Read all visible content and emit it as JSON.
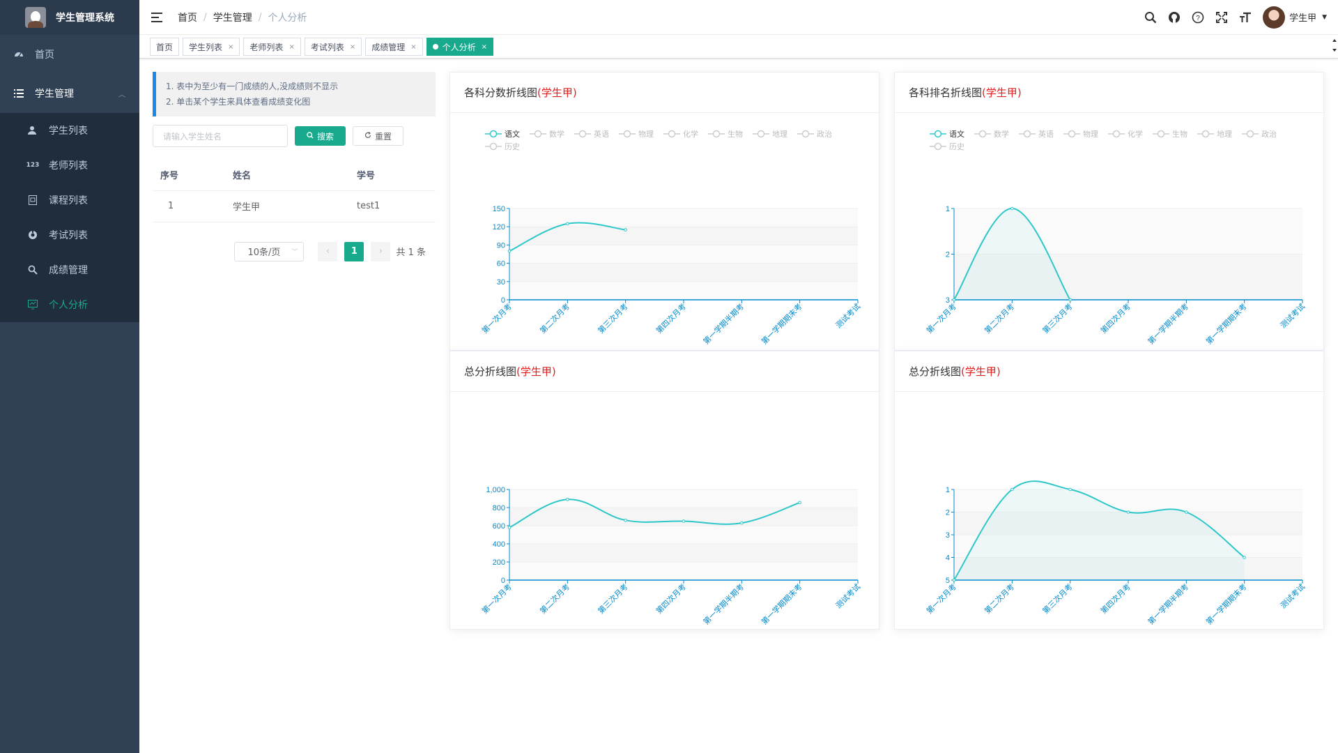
{
  "app": {
    "title": "学生管理系统"
  },
  "sidebar": {
    "home": "首页",
    "group": "学生管理",
    "items": [
      {
        "label": "学生列表",
        "icon": "user-icon"
      },
      {
        "label": "老师列表",
        "icon": "number-icon"
      },
      {
        "label": "课程列表",
        "icon": "course-icon"
      },
      {
        "label": "考试列表",
        "icon": "exam-icon"
      },
      {
        "label": "成绩管理",
        "icon": "search-icon"
      },
      {
        "label": "个人分析",
        "icon": "analysis-icon"
      }
    ]
  },
  "breadcrumb": {
    "home": "首页",
    "section": "学生管理",
    "current": "个人分析"
  },
  "user": {
    "name": "学生甲"
  },
  "tags": [
    {
      "label": "首页",
      "closable": false,
      "active": false
    },
    {
      "label": "学生列表",
      "closable": true,
      "active": false
    },
    {
      "label": "老师列表",
      "closable": true,
      "active": false
    },
    {
      "label": "考试列表",
      "closable": true,
      "active": false
    },
    {
      "label": "成绩管理",
      "closable": true,
      "active": false
    },
    {
      "label": "个人分析",
      "closable": true,
      "active": true
    }
  ],
  "tips": {
    "line1": "1. 表中为至少有一门成绩的人,没成绩则不显示",
    "line2": "2. 单击某个学生来具体查看成绩变化图"
  },
  "search": {
    "placeholder": "请输入学生姓名",
    "search_label": "搜索",
    "reset_label": "重置"
  },
  "table": {
    "headers": [
      "序号",
      "姓名",
      "学号"
    ],
    "rows": [
      [
        "1",
        "学生甲",
        "test1"
      ]
    ]
  },
  "pagination": {
    "page_size": "10条/页",
    "current_page": "1",
    "total": "共 1 条"
  },
  "colors": {
    "accent": "#19aa8d",
    "sidebar": "#304156",
    "line": "#2ec7c9",
    "axis": "#008acd",
    "highlight": "#e02020"
  },
  "cards": [
    {
      "title": "各科分数折线图",
      "who": "(学生甲)"
    },
    {
      "title": "各科排名折线图",
      "who": "(学生甲)"
    },
    {
      "title": "总分折线图",
      "who": "(学生甲)"
    },
    {
      "title": "总分折线图",
      "who": "(学生甲)"
    }
  ],
  "chart_data": [
    {
      "type": "line",
      "title": "各科分数折线图(学生甲)",
      "legend": [
        "语文",
        "数学",
        "英语",
        "物理",
        "化学",
        "生物",
        "地理",
        "政治",
        "历史"
      ],
      "legend_active": "语文",
      "categories": [
        "第一次月考",
        "第二次月考",
        "第三次月考",
        "第四次月考",
        "第一学期半期考",
        "第一学期期末考",
        "测试考试"
      ],
      "series": [
        {
          "name": "语文",
          "values": [
            80,
            125,
            115,
            null,
            null,
            null,
            null
          ]
        }
      ],
      "yticks": [
        0,
        30,
        60,
        90,
        120,
        150
      ],
      "ylim": [
        0,
        150
      ],
      "inverse": false
    },
    {
      "type": "line",
      "title": "各科排名折线图(学生甲)",
      "legend": [
        "语文",
        "数学",
        "英语",
        "物理",
        "化学",
        "生物",
        "地理",
        "政治",
        "历史"
      ],
      "legend_active": "语文",
      "categories": [
        "第一次月考",
        "第二次月考",
        "第三次月考",
        "第四次月考",
        "第一学期半期考",
        "第一学期期末考",
        "测试考试"
      ],
      "series": [
        {
          "name": "语文",
          "values": [
            3,
            1,
            3,
            null,
            null,
            null,
            null
          ]
        }
      ],
      "yticks": [
        1,
        2,
        3
      ],
      "ylim": [
        1,
        3
      ],
      "inverse": true,
      "area": true
    },
    {
      "type": "line",
      "title": "总分折线图(学生甲)",
      "legend": [],
      "categories": [
        "第一次月考",
        "第二次月考",
        "第三次月考",
        "第四次月考",
        "第一学期半期考",
        "第一学期期末考",
        "测试考试"
      ],
      "series": [
        {
          "name": "",
          "values": [
            580,
            890,
            660,
            650,
            630,
            855,
            null
          ]
        }
      ],
      "yticks": [
        0,
        200,
        400,
        600,
        800,
        1000
      ],
      "ytick_labels": [
        "0",
        "200",
        "400",
        "600",
        "800",
        "1,000"
      ],
      "ylim": [
        0,
        1000
      ],
      "inverse": false
    },
    {
      "type": "line",
      "title": "总分折线图(学生甲)",
      "legend": [],
      "categories": [
        "第一次月考",
        "第二次月考",
        "第三次月考",
        "第四次月考",
        "第一学期半期考",
        "第一学期期末考",
        "测试考试"
      ],
      "series": [
        {
          "name": "",
          "values": [
            5,
            1,
            1,
            2,
            2,
            4,
            null
          ]
        }
      ],
      "yticks": [
        1,
        2,
        3,
        4,
        5
      ],
      "ylim": [
        1,
        5
      ],
      "inverse": true,
      "area": true
    }
  ]
}
